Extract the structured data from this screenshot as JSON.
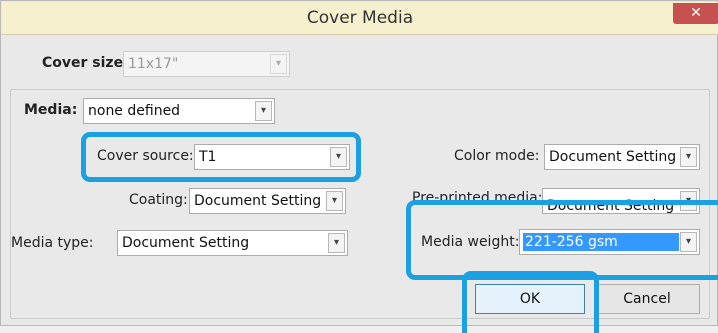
{
  "window": {
    "title": "Cover Media",
    "close_glyph": "✕"
  },
  "cover_size": {
    "label": "Cover size:",
    "value": "11x17\""
  },
  "media": {
    "label": "Media:",
    "value": "none defined"
  },
  "cover_source": {
    "label": "Cover source:",
    "value": "T1"
  },
  "coating": {
    "label": "Coating:",
    "value": "Document Setting"
  },
  "media_type": {
    "label": "Media type:",
    "value": "Document Setting"
  },
  "color_mode": {
    "label": "Color mode:",
    "value": "Document Setting"
  },
  "preprinted_media": {
    "label": "Pre-printed media:",
    "value": "Document Setting"
  },
  "media_weight": {
    "label": "Media weight:",
    "value": "221-256 gsm"
  },
  "buttons": {
    "ok": "OK",
    "cancel": "Cancel"
  },
  "icons": {
    "dropdown": "chevron-down-icon",
    "close": "close-icon"
  },
  "colors": {
    "highlight": "#1ba1e2",
    "titlebar": "#f7f0cf",
    "selection": "#3399ff",
    "close": "#c75050"
  }
}
